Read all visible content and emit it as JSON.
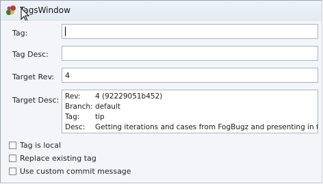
{
  "window": {
    "title": "TagsWindow"
  },
  "form": {
    "tag": {
      "label": "Tag:",
      "value": ""
    },
    "tag_desc": {
      "label": "Tag Desc:",
      "value": ""
    },
    "target_rev": {
      "label": "Target Rev:",
      "value": "4"
    },
    "target_desc": {
      "label": "Target Desc:",
      "rows": [
        {
          "key": "Rev:",
          "value": "4 (92229051b452)"
        },
        {
          "key": "Branch:",
          "value": "default"
        },
        {
          "key": "Tag:",
          "value": "tip"
        },
        {
          "key": "Desc:",
          "value": "Getting iterations and cases from FogBugz and presenting in the scre"
        }
      ]
    }
  },
  "options": [
    {
      "label": "Tag is local",
      "checked": false
    },
    {
      "label": "Replace existing tag",
      "checked": false
    },
    {
      "label": "Use custom commit message",
      "checked": false
    }
  ],
  "icons": {
    "app": "tortoisehg-app-icon",
    "cursor": "mouse-pointer-icon"
  }
}
